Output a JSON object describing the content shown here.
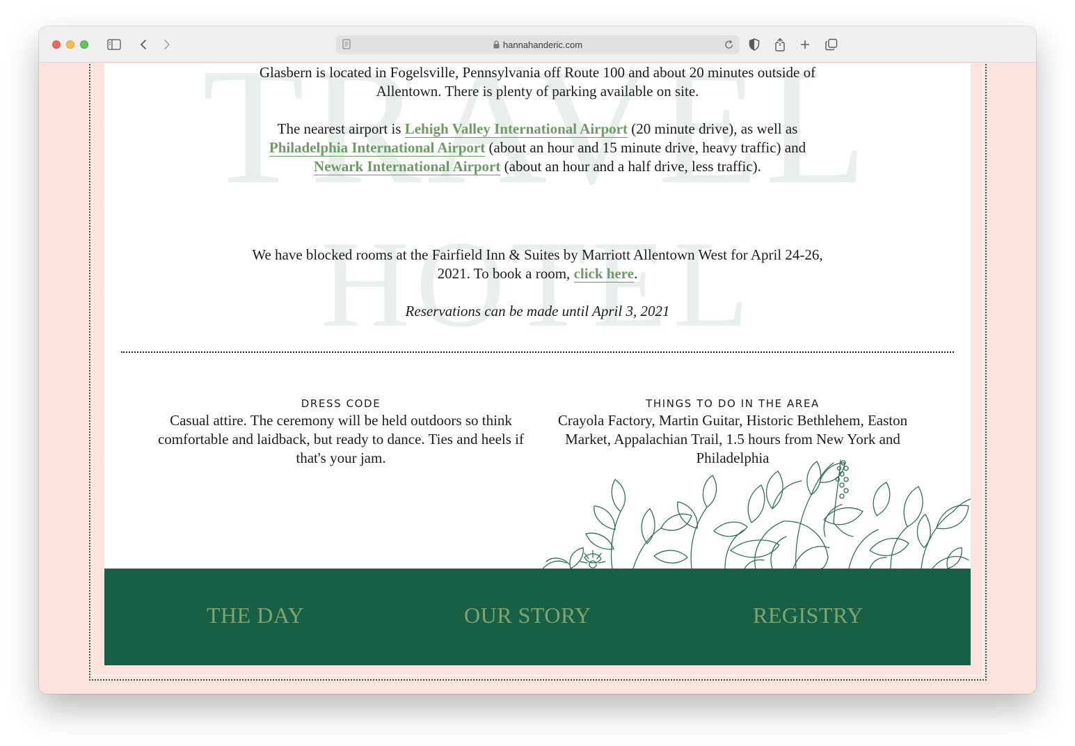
{
  "browser": {
    "url": "hannahanderic.com"
  },
  "watermarks": {
    "travel": "TRAVEL",
    "hotel": "HOTEL"
  },
  "travel": {
    "line1": "Glasbern is located in Fogelsville, Pennsylvania off Route 100 and about 20 minutes outside of",
    "line2": "Allentown. There is plenty of parking available on site.",
    "airport_intro": "The nearest airport is ",
    "airport1": "Lehigh Valley International Airport",
    "airport1_after": " (20 minute drive), as well as",
    "airport2": "Philadelphia International Airport",
    "airport2_after": " (about an hour and 15 minute drive, heavy traffic) and",
    "airport3": "Newark International Airport",
    "airport3_after": " (about an hour and a half drive, less traffic)."
  },
  "hotel": {
    "line1": "We have blocked rooms at the Fairfield Inn & Suites by Marriott Allentown West for April 24-26,",
    "line2_before": "2021. To book a room, ",
    "link": "click here",
    "line2_after": ".",
    "reservation_note": "Reservations can be made until April 3, 2021"
  },
  "dress_code": {
    "heading": "DRESS CODE",
    "text": "Casual attire. The ceremony will be held outdoors so think comfortable and laidback, but ready to dance. Ties and heels if that's your jam."
  },
  "things_to_do": {
    "heading": "THINGS TO DO IN THE AREA",
    "text": "Crayola Factory, Martin Guitar, Historic Bethlehem, Easton Market, Appalachian Trail, 1.5 hours from New York and Philadelphia"
  },
  "footer_nav": {
    "the_day": "THE DAY",
    "our_story": "OUR STORY",
    "registry": "REGISTRY"
  },
  "colors": {
    "page_background": "#fde3dd",
    "footer_green": "#186045",
    "link_green": "#6e9a66",
    "nav_green": "#7ea46f",
    "watermark": "#e9efeb"
  },
  "icons": [
    "sidebar-icon",
    "back-icon",
    "forward-icon",
    "reader-icon",
    "lock-icon",
    "reload-icon",
    "privacy-shield-icon",
    "share-icon",
    "new-tab-icon",
    "tab-overview-icon"
  ]
}
